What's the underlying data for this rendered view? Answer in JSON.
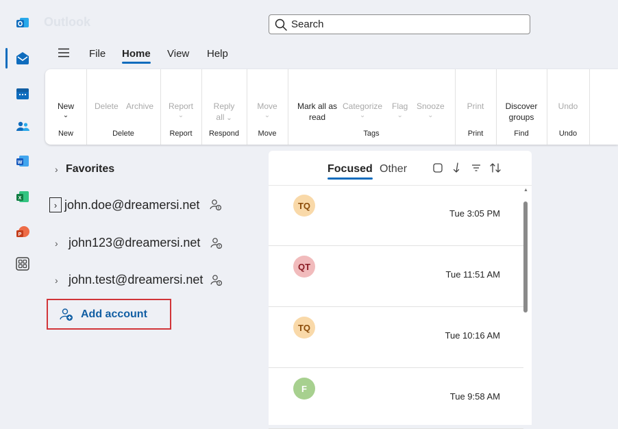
{
  "app": {
    "title": "Outlook"
  },
  "search": {
    "placeholder": "Search"
  },
  "rail": {
    "icons": [
      "outlook-logo-icon",
      "mail-icon",
      "calendar-icon",
      "people-icon",
      "word-icon",
      "excel-icon",
      "powerpoint-icon",
      "apps-icon"
    ]
  },
  "menu": {
    "tabs": [
      "File",
      "Home",
      "View",
      "Help"
    ],
    "active": "Home"
  },
  "ribbon": {
    "new": {
      "label": "New",
      "group": "New"
    },
    "delete": {
      "delete_label": "Delete",
      "archive_label": "Archive",
      "group": "Delete"
    },
    "report": {
      "label": "Report",
      "group": "Report"
    },
    "respond": {
      "label1": "Reply",
      "label2": "all",
      "group": "Respond"
    },
    "move": {
      "label": "Move",
      "group": "Move"
    },
    "tags": {
      "markall_1": "Mark all as",
      "markall_2": "read",
      "categorize": "Categorize",
      "flag": "Flag",
      "snooze": "Snooze",
      "group": "Tags"
    },
    "print": {
      "label": "Print",
      "group": "Print"
    },
    "find": {
      "label1": "Discover",
      "label2": "groups",
      "group": "Find"
    },
    "undo": {
      "label": "Undo",
      "group": "Undo"
    }
  },
  "folders": {
    "favorites": "Favorites",
    "accounts": [
      "john.doe@dreamersi.net",
      "john123@dreamersi.net",
      "john.test@dreamersi.net"
    ],
    "add_account": "Add account"
  },
  "message_list": {
    "tabs": {
      "focused": "Focused",
      "other": "Other"
    },
    "messages": [
      {
        "initials": "TQ",
        "time": "Tue 3:05 PM",
        "color": "#f9d9a9",
        "text_color": "#8a4b08"
      },
      {
        "initials": "QT",
        "time": "Tue 11:51 AM",
        "color": "#f1bbbc",
        "text_color": "#8a1c24"
      },
      {
        "initials": "TQ",
        "time": "Tue 10:16 AM",
        "color": "#f9d9a9",
        "text_color": "#8a4b08"
      },
      {
        "initials": "F",
        "time": "Tue 9:58 AM",
        "color": "#a7d08f",
        "text_color": "#ffffff"
      }
    ]
  },
  "colors": {
    "accent": "#0f6cbd",
    "highlight_box": "#d13438"
  }
}
